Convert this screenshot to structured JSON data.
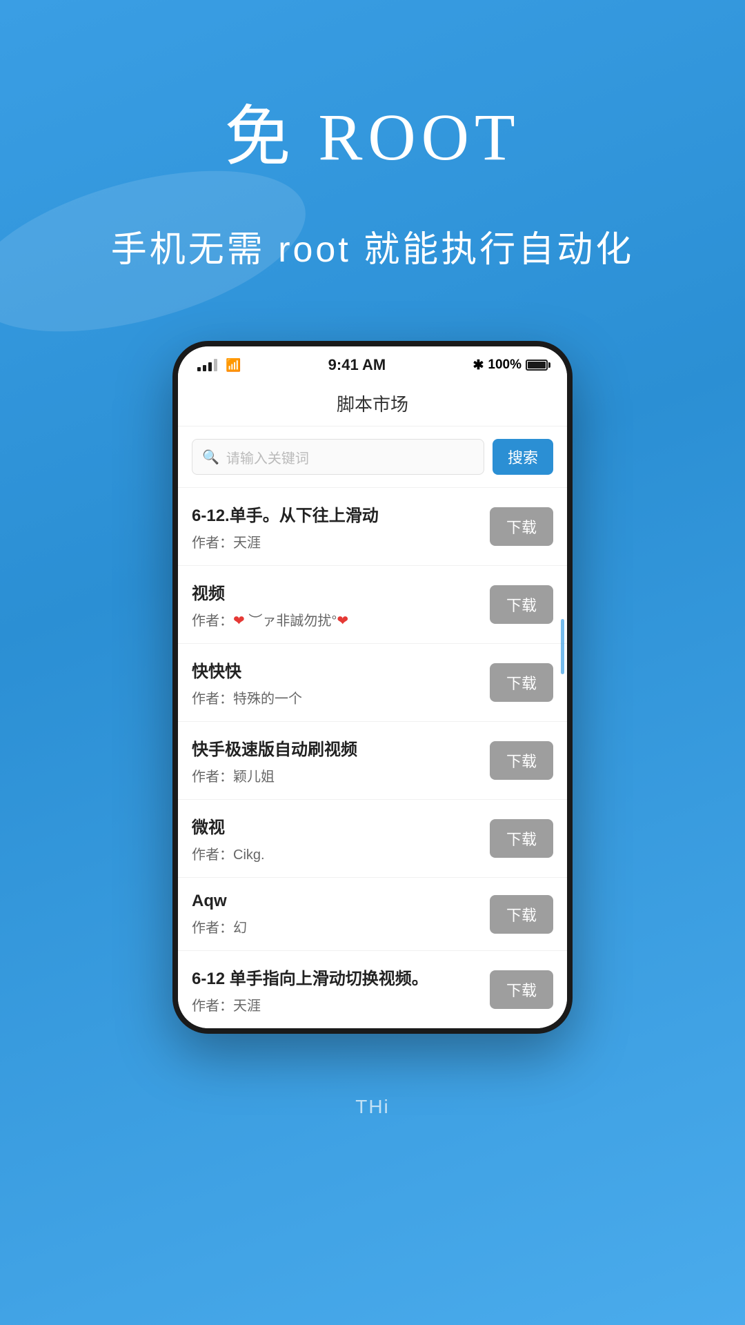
{
  "hero": {
    "title": "免 ROOT",
    "subtitle": "手机无需 root 就能执行自动化"
  },
  "phone": {
    "status_bar": {
      "time": "9:41 AM",
      "bluetooth": "✱",
      "battery_percent": "100%"
    },
    "app_title": "脚本市场",
    "search": {
      "placeholder": "请输入关键词",
      "button_label": "搜索"
    },
    "scripts": [
      {
        "name": "6-12.单手。从下往上滑动",
        "author": "作者：天涯",
        "download_label": "下载"
      },
      {
        "name": "视频",
        "author_prefix": "作者：",
        "author_heart1": "❤",
        "author_text": " ︶ァ非誠勿扰°",
        "author_heart2": "❤",
        "download_label": "下载"
      },
      {
        "name": "快快快",
        "author": "作者：特殊的一个",
        "download_label": "下载"
      },
      {
        "name": "快手极速版自动刷视频",
        "author": "作者：颖儿姐",
        "download_label": "下载"
      },
      {
        "name": "微视",
        "author": "作者：Cikg.",
        "download_label": "下载"
      },
      {
        "name": "Aqw",
        "author": "作者：幻",
        "download_label": "下载"
      },
      {
        "name": "6-12 单手指向上滑动切换视频。",
        "author": "作者：天涯",
        "download_label": "下载"
      }
    ]
  },
  "bottom": {
    "hint": "THi"
  }
}
